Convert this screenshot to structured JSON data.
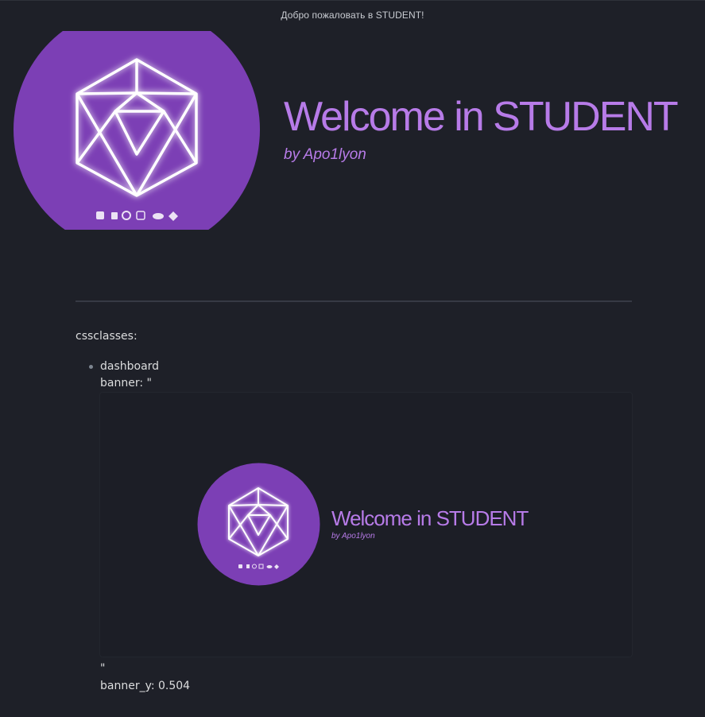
{
  "header": {
    "notice": "Добро пожаловать в STUDENT!"
  },
  "hero": {
    "title": "Welcome in STUDENT",
    "subtitle": "by Apo1lyon",
    "logo_color": "#7c3fb5",
    "logo_icons": [
      "puzzle-icon",
      "file-icon",
      "refresh-icon",
      "sync-icon",
      "docker-icon",
      "git-icon"
    ]
  },
  "content": {
    "cssclasses_label": "cssclasses:",
    "list_item": "dashboard",
    "banner_line": "banner: \"",
    "closing_quote": "\"",
    "banner_y_line": "banner_y: 0.504"
  },
  "embed": {
    "title": "Welcome in STUDENT",
    "subtitle": "by Apo1lyon"
  },
  "colors": {
    "background": "#1e2028",
    "accent": "#b77be8",
    "logo_purple": "#7c3fb5"
  }
}
